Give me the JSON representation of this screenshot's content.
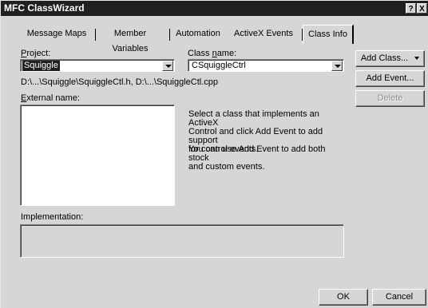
{
  "window": {
    "title": "MFC ClassWizard",
    "help_button": "?",
    "close_button": "X"
  },
  "tabs": [
    {
      "label": "Message Maps"
    },
    {
      "label": "Member Variables"
    },
    {
      "label": "Automation"
    },
    {
      "label": "ActiveX Events"
    },
    {
      "label": "Class Info"
    }
  ],
  "form": {
    "project_label": "Project:",
    "project_value": "Squiggle",
    "class_name_label": "Class name:",
    "class_name_value": "CSquiggleCtrl",
    "file_path": "D:\\...\\Squiggle\\SquiggleCtl.h, D:\\...\\SquiggleCtl.cpp",
    "external_name_label": "External name:",
    "info_text_1": "Select a class that implements an ActiveX\nControl and click Add Event to add support\nfor control events.",
    "info_text_2": "You can use Add Event to add both stock\nand custom events.",
    "implementation_label": "Implementation:"
  },
  "side_buttons": {
    "add_class": "Add Class...",
    "add_event": "Add Event...",
    "delete": "Delete"
  },
  "footer_buttons": {
    "ok": "OK",
    "cancel": "Cancel"
  }
}
